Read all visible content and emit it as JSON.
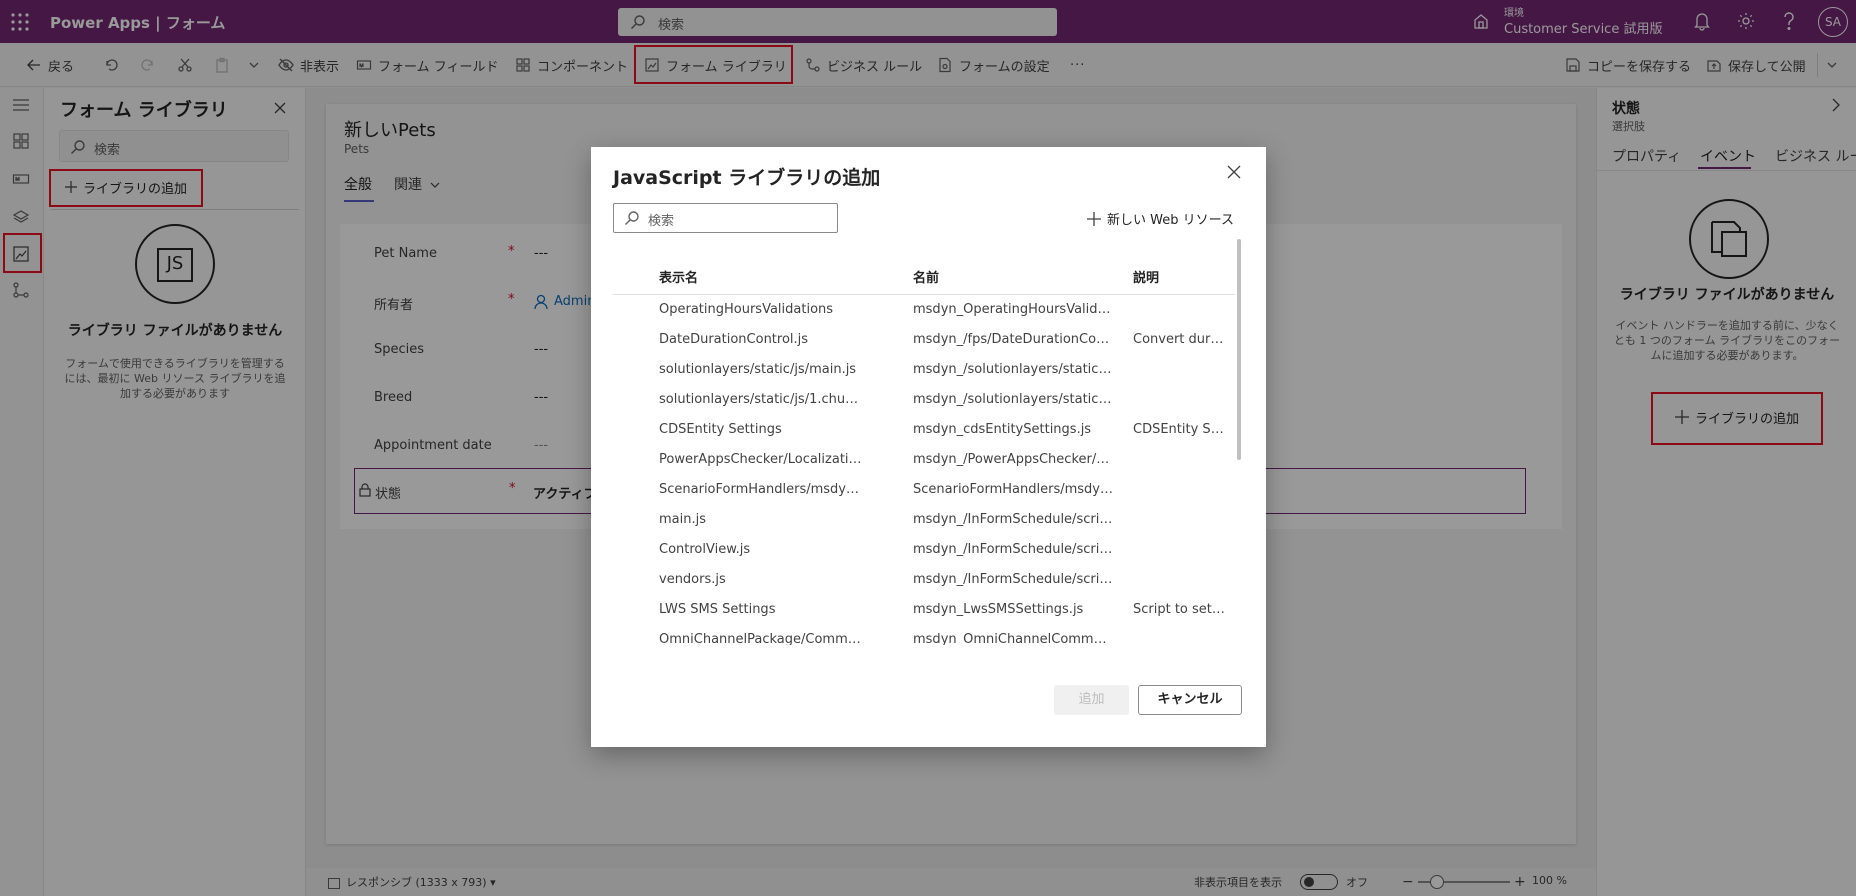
{
  "app": {
    "title": "Power Apps  |  フォーム"
  },
  "topbar": {
    "search_placeholder": "検索",
    "env_label": "環境",
    "env_name": "Customer Service 試用版",
    "avatar": "SA"
  },
  "cmdbar": {
    "back": "戻る",
    "hide": "非表示",
    "form_fields": "フォーム フィールド",
    "components": "コンポーネント",
    "form_library": "フォーム ライブラリ",
    "business_rules": "ビジネス ルール",
    "form_settings": "フォームの設定",
    "more": "···",
    "save_copy": "コピーを保存する",
    "save_publish": "保存して公開"
  },
  "libpanel": {
    "title": "フォーム ライブラリ",
    "search_placeholder": "検索",
    "add_label": "ライブラリの追加",
    "empty_title": "ライブラリ ファイルがありません",
    "empty_desc": "フォームで使用できるライブラリを管理するには、最初に Web リソース ライブラリを追加する必要があります",
    "js_icon_text": "JS"
  },
  "form": {
    "title": "新しいPets",
    "entity": "Pets",
    "tabs": [
      "全般",
      "関連"
    ],
    "fields": [
      {
        "label": "Pet Name",
        "required": "*",
        "value": "---"
      },
      {
        "label": "所有者",
        "required": "*",
        "value": "Admin"
      },
      {
        "label": "Species",
        "required": "",
        "value": "---"
      },
      {
        "label": "Breed",
        "required": "",
        "value": "---"
      },
      {
        "label": "Appointment date",
        "required": "",
        "value": "---"
      },
      {
        "label": "状態",
        "required": "*",
        "value": "アクティブ"
      }
    ]
  },
  "bottombar": {
    "responsive": "レスポンシブ (1333 x 793)",
    "show_hidden": "非表示項目を表示",
    "toggle_state": "オフ",
    "zoom": "100 %"
  },
  "rpanel": {
    "title": "状態",
    "subtitle": "選択肢",
    "tabs": [
      "プロパティ",
      "イベント",
      "ビジネス ルール"
    ],
    "empty_title": "ライブラリ ファイルがありません",
    "empty_desc": "イベント ハンドラーを追加する前に、少なくとも 1 つのフォーム ライブラリをこのフォームに追加する必要があります。",
    "add_label": "ライブラリの追加"
  },
  "dialog": {
    "title": "JavaScript ライブラリの追加",
    "search_placeholder": "検索",
    "new_web_resource": "新しい Web リソース",
    "columns": [
      "表示名",
      "名前",
      "説明"
    ],
    "rows": [
      [
        "OperatingHoursValidations",
        "msdyn_OperatingHoursValidatio...",
        ""
      ],
      [
        "DateDurationControl.js",
        "msdyn_/fps/DateDurationControl...",
        "Convert durati..."
      ],
      [
        "solutionlayers/static/js/main.js",
        "msdyn_/solutionlayers/static/js/...",
        ""
      ],
      [
        "solutionlayers/static/js/1.chunk.js",
        "msdyn_/solutionlayers/static/js/1...",
        ""
      ],
      [
        "CDSEntity Settings",
        "msdyn_cdsEntitySettings.js",
        "CDSEntity Sett..."
      ],
      [
        "PowerAppsChecker/Localization/Resou...",
        "msdyn_/PowerAppsChecker/Loca...",
        ""
      ],
      [
        "ScenarioFormHandlers/msdyn_TypeFie...",
        "ScenarioFormHandlers/msdyn_Ty...",
        ""
      ],
      [
        "main.js",
        "msdyn_/InFormSchedule/script/d...",
        ""
      ],
      [
        "ControlView.js",
        "msdyn_/InFormSchedule/script/d...",
        ""
      ],
      [
        "vendors.js",
        "msdyn_/InFormSchedule/script/d...",
        ""
      ],
      [
        "LWS SMS Settings",
        "msdyn_LwsSMSSettings.js",
        "Script to set vi..."
      ],
      [
        "OmniChannelPackage/CommandBarAc...",
        "msdyn_OmniChannelCommandB...",
        ""
      ]
    ],
    "add_button": "追加",
    "cancel_button": "キャンセル"
  },
  "colors": {
    "brand": "#742774",
    "highlight": "#e81123"
  }
}
